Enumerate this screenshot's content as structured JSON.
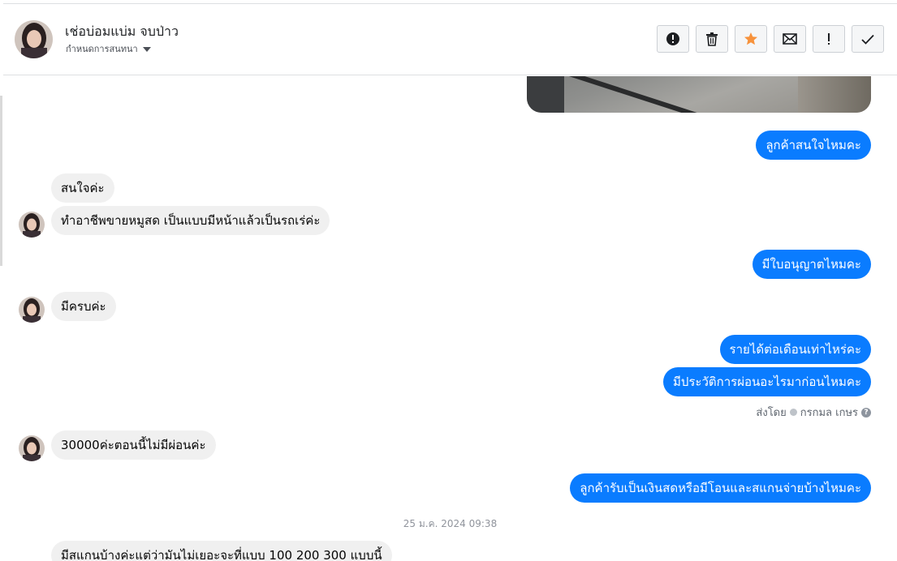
{
  "header": {
    "contact_name": "เช่อบ่อมแบ่ม จบป่าว",
    "subtitle": "กำหนดการสนทนา",
    "actions": [
      {
        "icon": "alert-circle-icon"
      },
      {
        "icon": "trash-icon"
      },
      {
        "icon": "star-icon",
        "color": "#f7923b"
      },
      {
        "icon": "envelope-icon"
      },
      {
        "icon": "exclamation-icon"
      },
      {
        "icon": "checkmark-icon"
      }
    ]
  },
  "messages": [
    {
      "dir": "out",
      "text": "ลูกค้าสนใจไหมคะ"
    },
    {
      "dir": "in",
      "text": "สนใจค่ะ"
    },
    {
      "dir": "in",
      "text": "ทำอาชีพขายหมูสด เป็นแบบมีหน้าแล้วเป็นรถเร่ค่ะ"
    },
    {
      "dir": "out",
      "text": "มีใบอนุญาตไหมคะ"
    },
    {
      "dir": "in",
      "text": "มีครบค่ะ"
    },
    {
      "dir": "out",
      "text": "รายได้ต่อเดือนเท่าไหร่คะ"
    },
    {
      "dir": "out",
      "text": "มีประวัติการผ่อนอะไรมาก่อนไหมคะ"
    },
    {
      "dir": "in",
      "text": "30000ค่ะตอนนี้ไม่มีผ่อนค่ะ"
    },
    {
      "dir": "out",
      "text": "ลูกค้ารับเป็นเงินสดหรือมีโอนและสแกนจ่ายบ้างไหมคะ"
    },
    {
      "dir": "in",
      "text": "มีสแกนบ้างค่ะแต่ว่ามันไม่เยอะจะที่แบบ 100 200 300 แบบนี้"
    }
  ],
  "sent_by": {
    "prefix": "ส่งโดย",
    "name": "กรกมล เกษร"
  },
  "timestamp": "25 ม.ค. 2024 09:38",
  "colors": {
    "outgoing": "#0a7cff",
    "incoming": "#f0f0f0",
    "star": "#f7923b"
  }
}
